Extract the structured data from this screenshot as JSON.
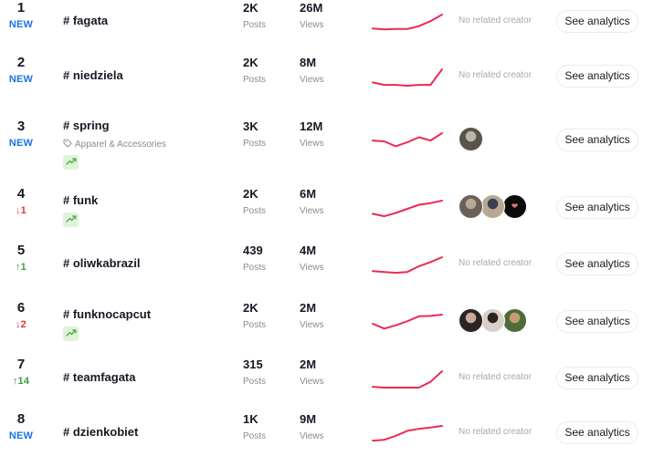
{
  "colors": {
    "sparkline": "#ea2b55",
    "new": "#1a74e8",
    "down": "#e0343f",
    "up": "#3f9c35"
  },
  "labels": {
    "posts": "Posts",
    "views": "Views",
    "no_creator": "No related creator",
    "see_analytics": "See analytics"
  },
  "rows": [
    {
      "rank": "1",
      "change": "NEW",
      "change_type": "new",
      "hashtag": "# fagata",
      "category": null,
      "trending_badge": false,
      "posts": "2K",
      "views": "26M",
      "trend": [
        0.15,
        0.1,
        0.12,
        0.12,
        0.3,
        0.6,
        1.0
      ],
      "creators": []
    },
    {
      "rank": "2",
      "change": "NEW",
      "change_type": "new",
      "hashtag": "# niedziela",
      "category": null,
      "trending_badge": false,
      "posts": "2K",
      "views": "8M",
      "trend": [
        0.2,
        0.05,
        0.05,
        0.0,
        0.05,
        0.05,
        1.0
      ],
      "creators": []
    },
    {
      "rank": "3",
      "change": "NEW",
      "change_type": "new",
      "hashtag": "# spring",
      "category": "Apparel & Accessories",
      "trending_badge": true,
      "posts": "3K",
      "views": "12M",
      "trend": [
        0.55,
        0.5,
        0.2,
        0.45,
        0.75,
        0.55,
        1.0
      ],
      "creators": [
        "creator-1"
      ]
    },
    {
      "rank": "4",
      "change": "↓1",
      "change_type": "down",
      "hashtag": "# funk",
      "category": null,
      "trending_badge": true,
      "posts": "2K",
      "views": "6M",
      "trend": [
        0.2,
        0.05,
        0.25,
        0.5,
        0.75,
        0.85,
        1.0
      ],
      "creators": [
        "creator-1",
        "creator-2",
        "creator-3"
      ]
    },
    {
      "rank": "5",
      "change": "↑1",
      "change_type": "up",
      "hashtag": "# oliwkabrazil",
      "category": null,
      "trending_badge": false,
      "posts": "439",
      "views": "4M",
      "trend": [
        0.15,
        0.1,
        0.05,
        0.1,
        0.45,
        0.7,
        1.0
      ],
      "creators": []
    },
    {
      "rank": "6",
      "change": "↓2",
      "change_type": "down",
      "hashtag": "# funknocapcut",
      "category": null,
      "trending_badge": true,
      "posts": "2K",
      "views": "2M",
      "trend": [
        0.45,
        0.15,
        0.35,
        0.6,
        0.9,
        0.92,
        1.0
      ],
      "creators": [
        "creator-1",
        "creator-2",
        "creator-3"
      ]
    },
    {
      "rank": "7",
      "change": "↑14",
      "change_type": "up",
      "hashtag": "# teamfagata",
      "category": null,
      "trending_badge": false,
      "posts": "315",
      "views": "2M",
      "trend": [
        0.05,
        0.0,
        0.0,
        0.0,
        0.0,
        0.35,
        1.0
      ],
      "creators": []
    },
    {
      "rank": "8",
      "change": "NEW",
      "change_type": "new",
      "hashtag": "# dzienkobiet",
      "category": null,
      "trending_badge": false,
      "posts": "1K",
      "views": "9M",
      "trend": [
        0.1,
        0.15,
        0.4,
        0.7,
        0.82,
        0.9,
        1.0
      ],
      "creators": []
    }
  ]
}
